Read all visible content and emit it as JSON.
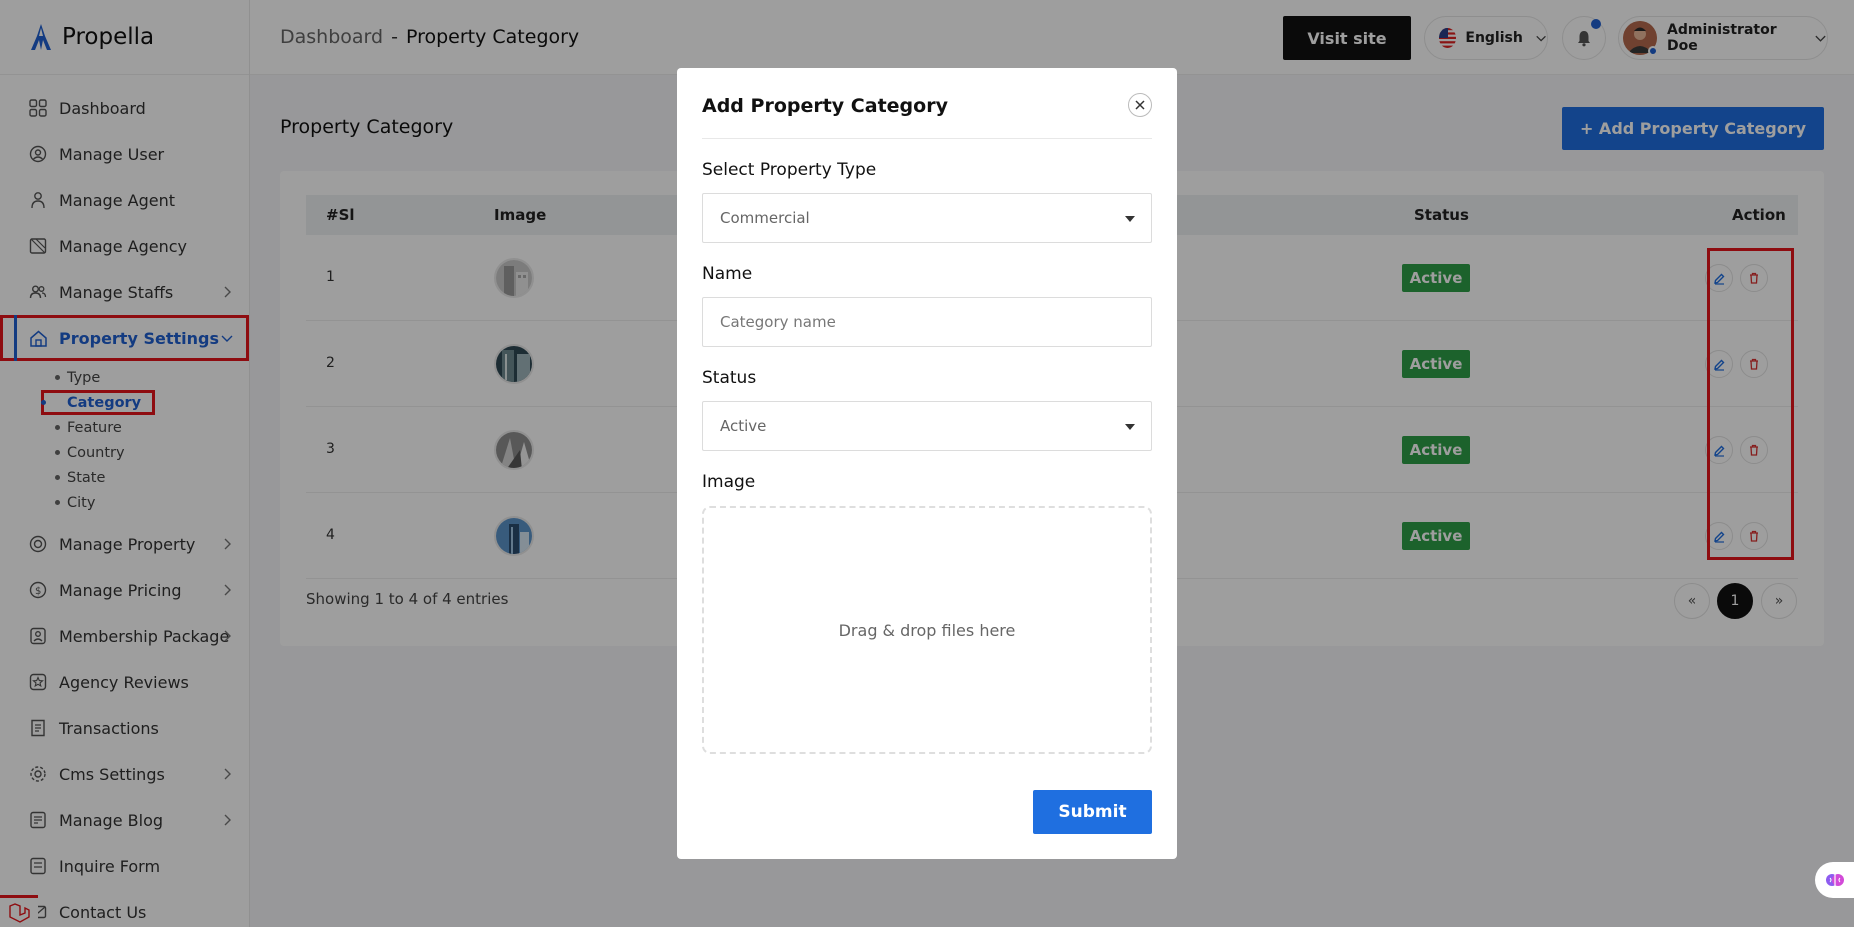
{
  "brand": {
    "name": "Propella"
  },
  "sidebar": {
    "items": [
      {
        "label": "Dashboard",
        "icon": "grid-icon"
      },
      {
        "label": "Manage User",
        "icon": "user-circle-icon"
      },
      {
        "label": "Manage Agent",
        "icon": "agent-icon"
      },
      {
        "label": "Manage Agency",
        "icon": "agency-icon"
      },
      {
        "label": "Manage Staffs",
        "icon": "users-icon"
      },
      {
        "label": "Property Settings",
        "icon": "home-icon"
      },
      {
        "label": "Manage Property",
        "icon": "property-icon"
      },
      {
        "label": "Manage Pricing",
        "icon": "pricing-icon"
      },
      {
        "label": "Membership Package",
        "icon": "membership-icon"
      },
      {
        "label": "Agency Reviews",
        "icon": "star-icon"
      },
      {
        "label": "Transactions",
        "icon": "receipt-icon"
      },
      {
        "label": "Cms Settings",
        "icon": "cog-icon"
      },
      {
        "label": "Manage Blog",
        "icon": "blog-icon"
      },
      {
        "label": "Inquire Form",
        "icon": "form-icon"
      },
      {
        "label": "Contact Us",
        "icon": "contact-icon"
      }
    ],
    "subitems": [
      "Type",
      "Category",
      "Feature",
      "Country",
      "State",
      "City"
    ]
  },
  "header": {
    "crumb_parent": "Dashboard",
    "crumb_sep": "-",
    "crumb_current": "Property Category",
    "visit_site": "Visit site",
    "language": "English",
    "user_name": "Administrator Doe"
  },
  "main": {
    "title": "Property Category",
    "add_button": "+ Add Property Category",
    "columns": {
      "sl": "#Sl",
      "image": "Image",
      "status": "Status",
      "action": "Action"
    },
    "rows": [
      {
        "num": "1",
        "status": "Active"
      },
      {
        "num": "2",
        "status": "Active"
      },
      {
        "num": "3",
        "status": "Active"
      },
      {
        "num": "4",
        "status": "Active"
      }
    ],
    "entries": "Showing 1 to 4 of 4 entries",
    "pager": {
      "prev": "«",
      "page": "1",
      "next": "»"
    }
  },
  "modal": {
    "title": "Add Property Category",
    "type_label": "Select Property Type",
    "type_value": "Commercial",
    "name_label": "Name",
    "name_placeholder": "Category name",
    "status_label": "Status",
    "status_value": "Active",
    "image_label": "Image",
    "dropzone_text": "Drag & drop files here",
    "submit": "Submit"
  },
  "colors": {
    "accent": "#1f6fe0",
    "active_badge": "#2e9e47",
    "highlight": "#e5141b"
  }
}
